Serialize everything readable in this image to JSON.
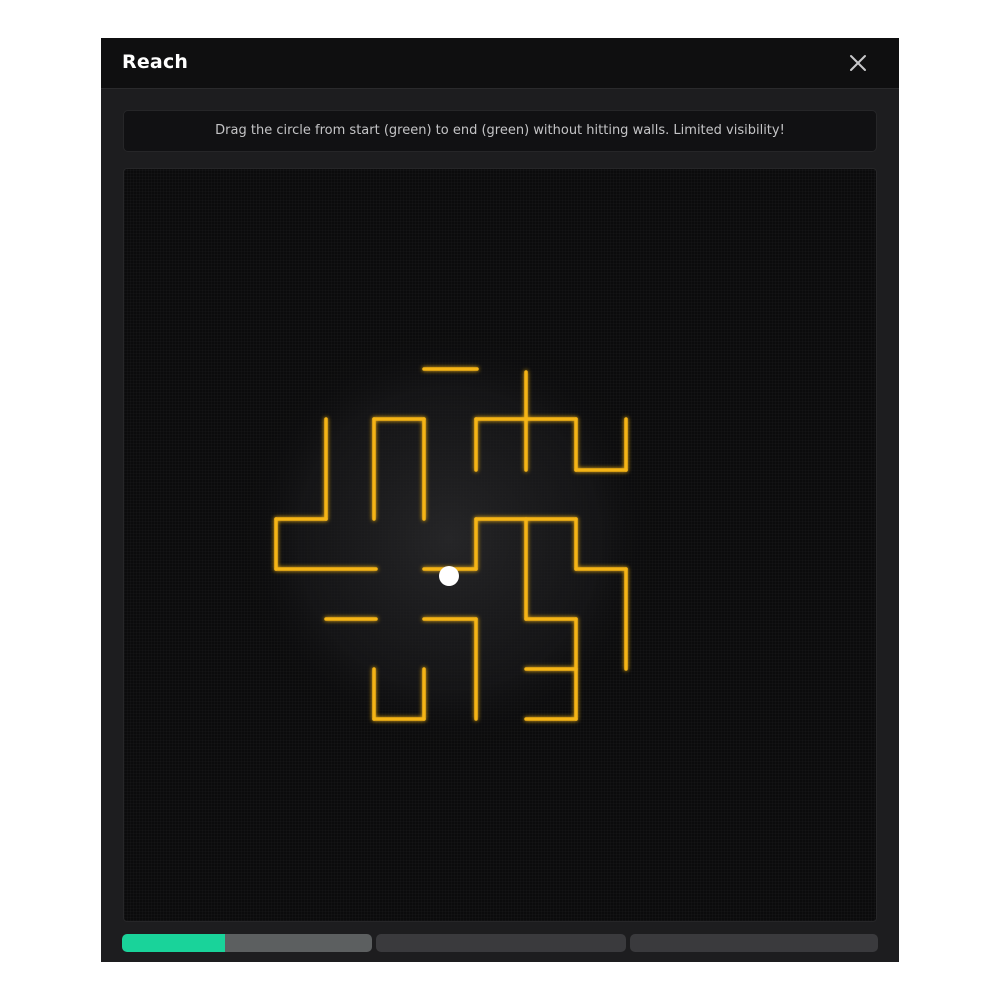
{
  "window": {
    "title": "Reach",
    "close_icon": "close-icon"
  },
  "instructions": "Drag the circle from start (green) to end (green) without hitting walls. Limited visibility!",
  "game": {
    "wall_color": "#f5b413",
    "player_color": "#ffffff",
    "goal_color": "#19d39a",
    "visibility": "limited"
  },
  "progress": {
    "segments_total": 3,
    "current_segment": 1,
    "current_segment_fill": 0.41,
    "fill_color": "#19d39a"
  }
}
